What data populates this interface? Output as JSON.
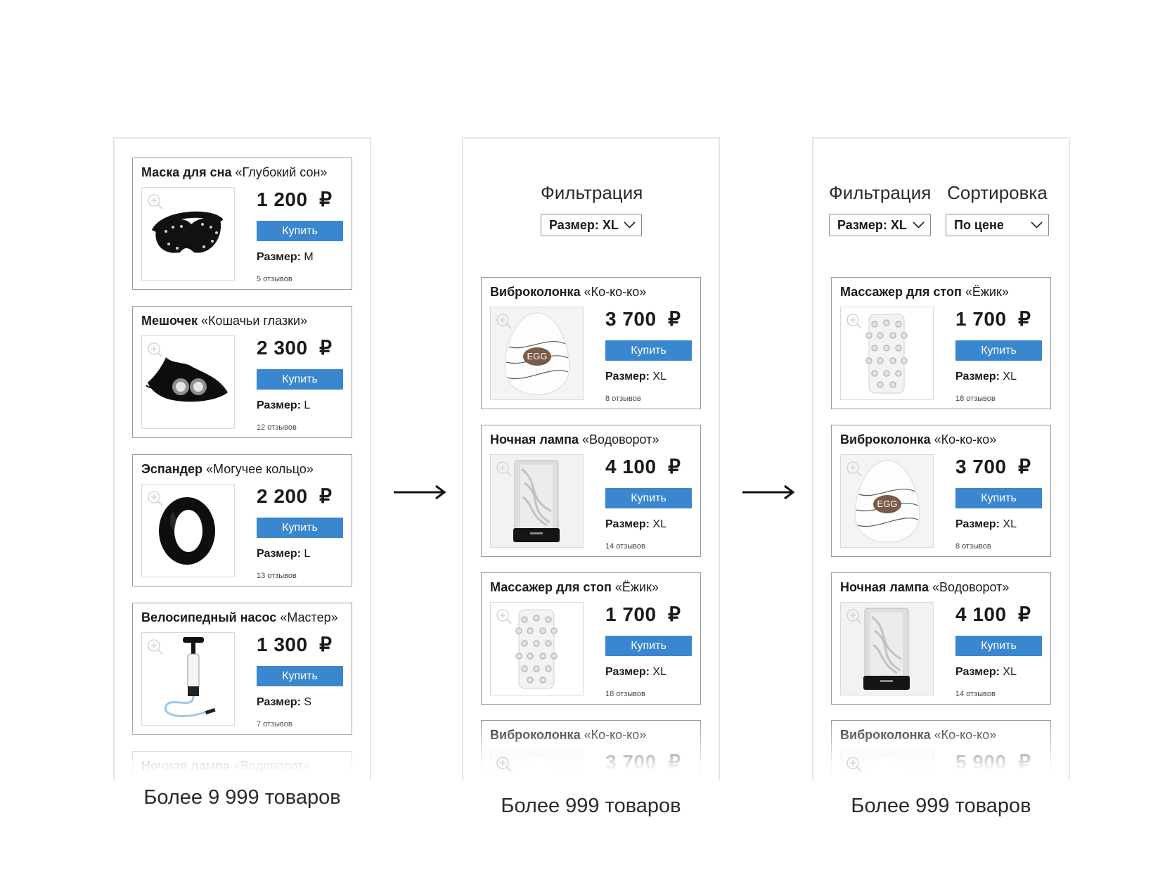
{
  "currency": "₽",
  "buy_label": "Купить",
  "size_label": "Размер:",
  "screens": [
    {
      "caption": "Более 9 999 товаров",
      "products": [
        {
          "name_bold": "Маска для сна",
          "name_rest": " «Глубокий сон»",
          "price": "1 200",
          "size": "M",
          "reviews": "5 отзывов",
          "image": "sleep-mask"
        },
        {
          "name_bold": "Мешочек",
          "name_rest": " «Кошачьи глазки»",
          "price": "2 300",
          "size": "L",
          "reviews": "12 отзывов",
          "image": "pouch-with-balls"
        },
        {
          "name_bold": "Эспандер",
          "name_rest": " «Могучее кольцо»",
          "price": "2 200",
          "size": "L",
          "reviews": "13 отзывов",
          "image": "black-ring"
        },
        {
          "name_bold": "Велосипедный насос",
          "name_rest": " «Мастер»",
          "price": "1 300",
          "size": "S",
          "reviews": "7 отзывов",
          "image": "hand-pump"
        },
        {
          "name_bold": "Ночная лампа",
          "name_rest": " «Водоворот»",
          "price": "",
          "size": "",
          "reviews": "",
          "image": "night-lamp"
        }
      ]
    },
    {
      "caption": "Более 999 товаров",
      "filter_title": "Фильтрация",
      "filter_value": "Размер: XL",
      "products": [
        {
          "name_bold": "Виброколонка",
          "name_rest": " «Ко-ко-ко»",
          "price": "3 700",
          "size": "XL",
          "reviews": "8 отзывов",
          "image": "egg-speaker"
        },
        {
          "name_bold": "Ночная лампа",
          "name_rest": " «Водоворот»",
          "price": "4 100",
          "size": "XL",
          "reviews": "14 отзывов",
          "image": "night-lamp"
        },
        {
          "name_bold": "Массажер для стоп",
          "name_rest": " «Ёжик»",
          "price": "1 700",
          "size": "XL",
          "reviews": "18 отзывов",
          "image": "spiky-massager"
        },
        {
          "name_bold": "Виброколонка",
          "name_rest": " «Ко-ко-ко»",
          "price": "3 700",
          "size": "",
          "reviews": "",
          "image": "egg-speaker"
        }
      ]
    },
    {
      "caption": "Более 999 товаров",
      "filter_title": "Фильтрация",
      "filter_value": "Размер: XL",
      "sort_title": "Сортировка",
      "sort_value": "По цене",
      "products": [
        {
          "name_bold": "Массажер для стоп",
          "name_rest": " «Ёжик»",
          "price": "1 700",
          "size": "XL",
          "reviews": "18 отзывов",
          "image": "spiky-massager"
        },
        {
          "name_bold": "Виброколонка",
          "name_rest": " «Ко-ко-ко»",
          "price": "3 700",
          "size": "XL",
          "reviews": "8 отзывов",
          "image": "egg-speaker"
        },
        {
          "name_bold": "Ночная лампа",
          "name_rest": " «Водоворот»",
          "price": "4 100",
          "size": "XL",
          "reviews": "14 отзывов",
          "image": "night-lamp"
        },
        {
          "name_bold": "Виброколонка",
          "name_rest": " «Ко-ко-ко»",
          "price": "5 900",
          "size": "",
          "reviews": "",
          "image": "egg-speaker"
        }
      ]
    }
  ]
}
